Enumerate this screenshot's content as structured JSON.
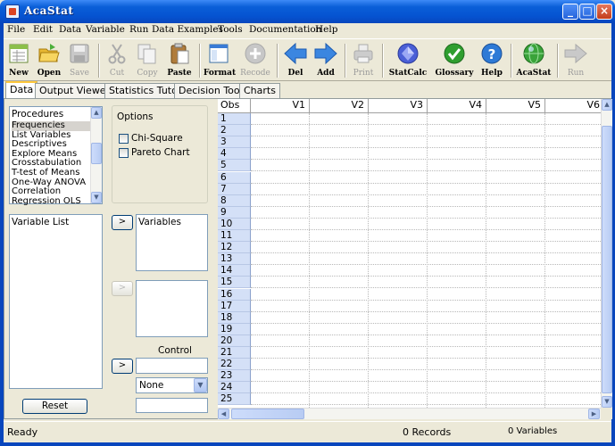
{
  "window": {
    "title": "AcaStat"
  },
  "menu": [
    "File",
    "Edit",
    "Data",
    "Variable",
    "Run",
    "Data Examples",
    "Tools",
    "Documentation",
    "Help"
  ],
  "toolbar": [
    {
      "label": "New",
      "icon": "new-icon",
      "enabled": true
    },
    {
      "label": "Open",
      "icon": "open-folder-icon",
      "enabled": true
    },
    {
      "label": "Save",
      "icon": "save-disk-icon",
      "enabled": false
    },
    {
      "label": "Cut",
      "icon": "scissors-icon",
      "enabled": false
    },
    {
      "label": "Copy",
      "icon": "copy-icon",
      "enabled": false
    },
    {
      "label": "Paste",
      "icon": "paste-clipboard-icon",
      "enabled": true
    },
    {
      "label": "Format",
      "icon": "format-window-icon",
      "enabled": true
    },
    {
      "label": "Recode",
      "icon": "recode-plus-icon",
      "enabled": false
    },
    {
      "label": "Del",
      "icon": "arrow-left-icon",
      "enabled": true
    },
    {
      "label": "Add",
      "icon": "arrow-right-icon",
      "enabled": true
    },
    {
      "label": "Print",
      "icon": "printer-icon",
      "enabled": false
    },
    {
      "label": "StatCalc",
      "icon": "statcalc-diamond-icon",
      "enabled": true
    },
    {
      "label": "Glossary",
      "icon": "checkmark-icon",
      "enabled": true
    },
    {
      "label": "Help",
      "icon": "question-icon",
      "enabled": true
    },
    {
      "label": "AcaStat",
      "icon": "globe-icon",
      "enabled": true
    },
    {
      "label": "Run",
      "icon": "run-arrow-icon",
      "enabled": false
    }
  ],
  "tabs": [
    {
      "label": "Data",
      "active": true
    },
    {
      "label": "Output Viewer",
      "active": false
    },
    {
      "label": "Statistics Tutor",
      "active": false
    },
    {
      "label": "Decision Tools",
      "active": false
    },
    {
      "label": "Charts",
      "active": false
    }
  ],
  "procedures": {
    "title": "Procedures",
    "items": [
      "Frequencies",
      "List Variables",
      "Descriptives",
      "Explore Means",
      "Crosstabulation",
      "T-test of Means",
      "One-Way ANOVA",
      "Correlation",
      "Regression OLS"
    ],
    "selected": "Frequencies"
  },
  "options": {
    "title": "Options",
    "items": [
      {
        "label": "Chi-Square",
        "checked": false
      },
      {
        "label": "Pareto Chart",
        "checked": false
      }
    ]
  },
  "variable_list": {
    "title": "Variable List"
  },
  "variables_box": {
    "title": "Variables"
  },
  "move_button": ">",
  "control": {
    "label": "Control",
    "select_value": "None"
  },
  "reset_button": "Reset",
  "grid": {
    "obs_header": "Obs",
    "columns": [
      "V1",
      "V2",
      "V3",
      "V4",
      "V5",
      "V6"
    ],
    "rows": [
      "1",
      "2",
      "3",
      "4",
      "5",
      "6",
      "7",
      "8",
      "9",
      "10",
      "11",
      "12",
      "13",
      "14",
      "15",
      "16",
      "17",
      "18",
      "19",
      "20",
      "21",
      "22",
      "23",
      "24",
      "25"
    ]
  },
  "status": {
    "left": "Ready",
    "records": "0 Records",
    "variables": "0 Variables"
  }
}
